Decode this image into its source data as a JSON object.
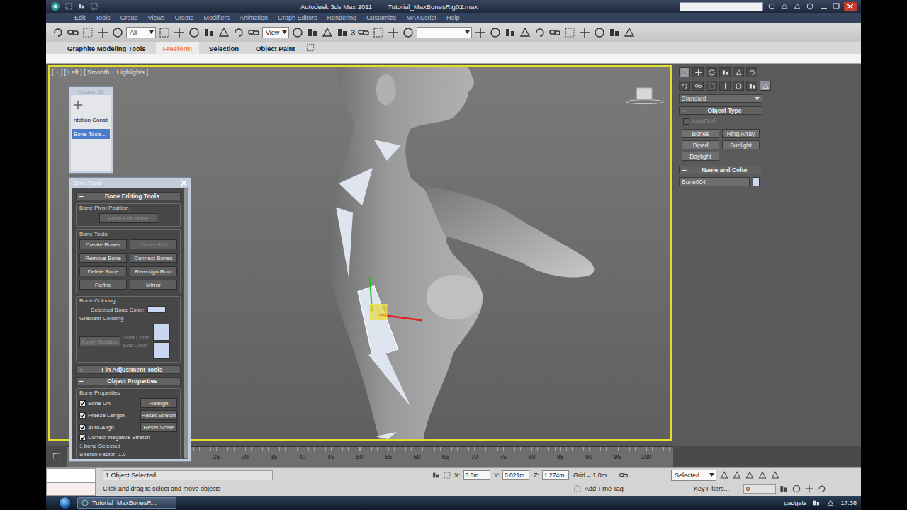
{
  "window": {
    "app": "Autodesk 3ds Max 2011",
    "file": "Tutorial_MaxBonesRig02.max"
  },
  "menu": [
    "Edit",
    "Tools",
    "Group",
    "Views",
    "Create",
    "Modifiers",
    "Animation",
    "Graph Editors",
    "Rendering",
    "Customize",
    "MAXScript",
    "Help"
  ],
  "toolbar": {
    "selection_filter": "All",
    "reference_coord": "View",
    "snap_label": "3"
  },
  "ribbon_tabs": [
    {
      "label": "Graphite Modeling Tools",
      "selected": false
    },
    {
      "label": "Freeform",
      "selected": true
    },
    {
      "label": "Selection",
      "selected": false
    },
    {
      "label": "Object Paint",
      "selected": false
    }
  ],
  "viewport": {
    "label": "[ + ] [ Left ] [ Smooth + Highlights ]",
    "bones": [
      {
        "selected": false
      },
      {
        "selected": false
      },
      {
        "selected": false
      },
      {
        "selected": true
      },
      {
        "selected": false
      },
      {
        "selected": false
      }
    ]
  },
  "custom_toolbar": {
    "title": "Custom 01",
    "items": [
      {
        "label": "ntation Consti",
        "selected": false
      },
      {
        "label": "Bone Tools...",
        "selected": true
      }
    ]
  },
  "bone_tools": {
    "title": "Bone Tools",
    "editing_header": "Bone Editing Tools",
    "pivot_group": "Bone Pivot Position",
    "edit_mode": {
      "label": "Bone Edit Mode",
      "disabled": true
    },
    "tools_group": "Bone Tools",
    "buttons": [
      {
        "label": "Create Bones",
        "disabled": false
      },
      {
        "label": "Create End",
        "disabled": true
      },
      {
        "label": "Remove Bone",
        "disabled": false
      },
      {
        "label": "Connect Bones",
        "disabled": false
      },
      {
        "label": "Delete Bone",
        "disabled": false
      },
      {
        "label": "Reassign Root",
        "disabled": false
      },
      {
        "label": "Refine",
        "disabled": false
      },
      {
        "label": "Mirror",
        "disabled": false
      }
    ],
    "coloring_group": "Bone Coloring",
    "selected_color_label": "Selected Bone Color:",
    "gradient_group": "Gradient Coloring",
    "apply_gradient": {
      "label": "Apply Gradient",
      "disabled": true
    },
    "start_color_label": "Start Color:",
    "end_color_label": "End Color:",
    "fin_header": {
      "label": "Fin Adjustment Tools",
      "expanded": false
    },
    "props_header": {
      "label": "Object Properties",
      "expanded": true
    },
    "props_group": "Bone Properties",
    "checks": [
      {
        "label": "Bone On",
        "checked": true,
        "button": "Realign"
      },
      {
        "label": "Freeze Length",
        "checked": true,
        "button": "Reset Stretch"
      },
      {
        "label": "Auto-Align",
        "checked": true,
        "button": "Reset Scale"
      },
      {
        "label": "Correct Negative Stretch",
        "checked": true,
        "button": ""
      }
    ],
    "selection_info": "1 bone Selected",
    "stretch_factor": "Stretch Factor: 1.0"
  },
  "command_panel": {
    "panel_tabs": [
      {
        "selected": true
      },
      {
        "selected": false
      },
      {
        "selected": false
      },
      {
        "selected": false
      },
      {
        "selected": false
      },
      {
        "selected": false
      }
    ],
    "create_categories": [
      {
        "selected": false
      },
      {
        "selected": false
      },
      {
        "selected": false
      },
      {
        "selected": false
      },
      {
        "selected": false
      },
      {
        "selected": false
      },
      {
        "selected": true
      }
    ],
    "category": "Standard",
    "object_type": {
      "title": "Object Type",
      "autogrid": {
        "label": "AutoGrid",
        "checked": false,
        "disabled": true
      },
      "buttons": [
        "Bones",
        "Ring Array",
        "Biped",
        "Sunlight",
        "Daylight"
      ]
    },
    "name_and_color": {
      "title": "Name and Color",
      "name": "Bone004"
    }
  },
  "timeline": {
    "ticks": [
      "25",
      "30",
      "35",
      "40",
      "45",
      "50",
      "55",
      "60",
      "65",
      "70",
      "75",
      "80",
      "85",
      "90",
      "95",
      "100"
    ]
  },
  "status": {
    "selection": "1 Object Selected",
    "prompt": "Click and drag to select and move objects",
    "coords": [
      {
        "axis": "X:",
        "value": "0.0m"
      },
      {
        "axis": "Y:",
        "value": "0.021m"
      },
      {
        "axis": "Z:",
        "value": "1.274m"
      }
    ],
    "grid": "Grid = 1.0m",
    "add_time_tag": "Add Time Tag",
    "key_mode": "Selected",
    "key_filters": "Key Filters...",
    "frame": "0"
  },
  "taskbar": {
    "task": "Tutorial_MaxBonesR...",
    "tray": "gadgets",
    "time": "17:38"
  }
}
